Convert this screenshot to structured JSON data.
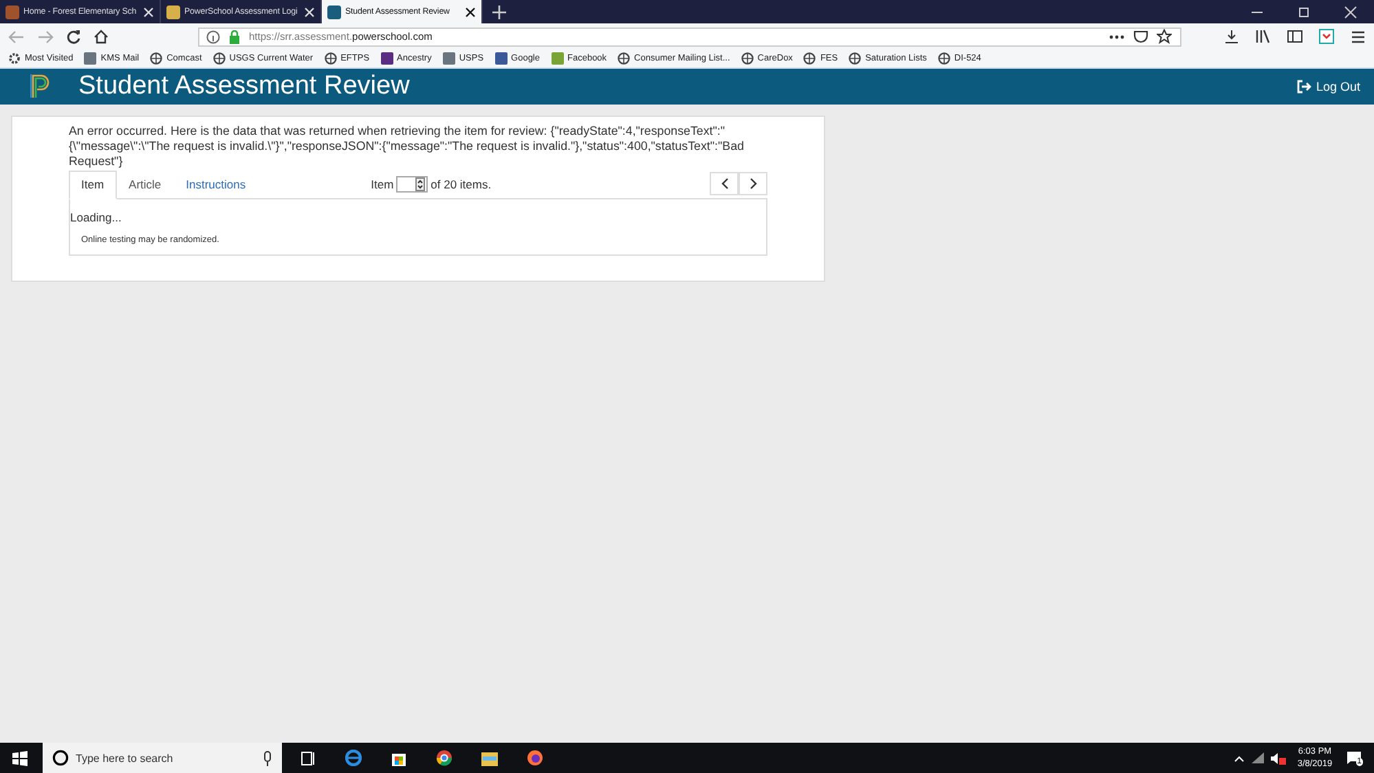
{
  "browser": {
    "tabs": [
      {
        "title": "Home - Forest Elementary Sch",
        "selected": false
      },
      {
        "title": "PowerSchool Assessment Logi",
        "selected": false
      },
      {
        "title": "Student Assessment Review",
        "selected": true
      }
    ],
    "address": "https://srr.assessment.**powerschool.com**",
    "bookmarks": [
      {
        "label": "Most Visited",
        "kind": "gear"
      },
      {
        "label": "KMS Mail",
        "kind": "favicon"
      },
      {
        "label": "Comcast",
        "kind": "globe"
      },
      {
        "label": "USGS Current Water",
        "kind": "globe"
      },
      {
        "label": "EFTPS",
        "kind": "globe"
      },
      {
        "label": "Ancestry",
        "kind": "favicon"
      },
      {
        "label": "USPS",
        "kind": "favicon"
      },
      {
        "label": "Google",
        "kind": "favicon"
      },
      {
        "label": "Facebook",
        "kind": "favicon"
      },
      {
        "label": "Consumer Mailing List...",
        "kind": "globe"
      },
      {
        "label": "CareDox",
        "kind": "globe"
      },
      {
        "label": "FES",
        "kind": "globe"
      },
      {
        "label": "Saturation Lists",
        "kind": "globe"
      },
      {
        "label": "DI-524",
        "kind": "globe"
      }
    ]
  },
  "app": {
    "title": "Student Assessment Review",
    "logout": "Log Out"
  },
  "error": "An error occurred. Here is the data that was returned when retrieving the item for review: {\"readyState\":4,\"responseText\":\"{\\\"message\\\":\\\"The request is invalid.\\\"}\",\"responseJSON\":{\"message\":\"The request is invalid.\"},\"status\":400,\"statusText\":\"Bad Request\"}",
  "tabs": [
    {
      "label": "Item",
      "selected": true
    },
    {
      "label": "Article",
      "selected": false
    },
    {
      "label": "Instructions",
      "selected": false
    }
  ],
  "pager": {
    "label": "Item",
    "suffix": "of 20 items."
  },
  "panel": {
    "status": "Loading...",
    "note": "Online testing may be randomized."
  },
  "taskbar": {
    "search_placeholder": "Type here to search",
    "time": "6:03 PM",
    "date": "3/8/2019",
    "notification_count": "1"
  }
}
